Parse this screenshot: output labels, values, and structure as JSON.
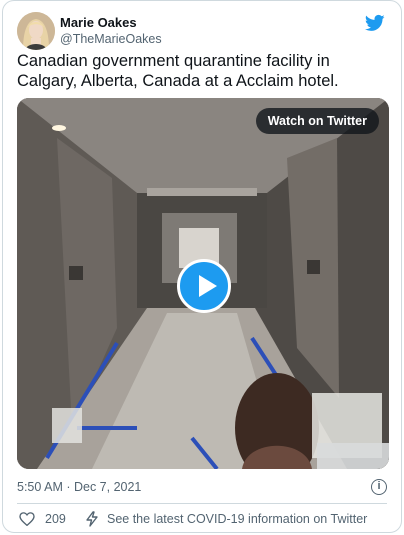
{
  "tweet": {
    "author_name": "Marie Oakes",
    "author_handle": "@TheMarieOakes",
    "text": "Canadian government quarantine facility in Calgary, Alberta, Canada at a Acclaim hotel.",
    "timestamp": "5:50 AM · Dec 7, 2021",
    "like_count": "209",
    "covid_notice": "See the latest COVID-19 information on Twitter"
  },
  "media": {
    "watch_label": "Watch on Twitter",
    "play_icon": "play-icon"
  },
  "icons": {
    "brand": "twitter-bird-icon",
    "info": "info-icon",
    "like": "heart-icon",
    "notice": "lightning-bolt-icon"
  },
  "colors": {
    "accent": "#1d9bf0",
    "text": "#0f1419",
    "secondary_text": "#536471",
    "border": "#cfd9de"
  }
}
